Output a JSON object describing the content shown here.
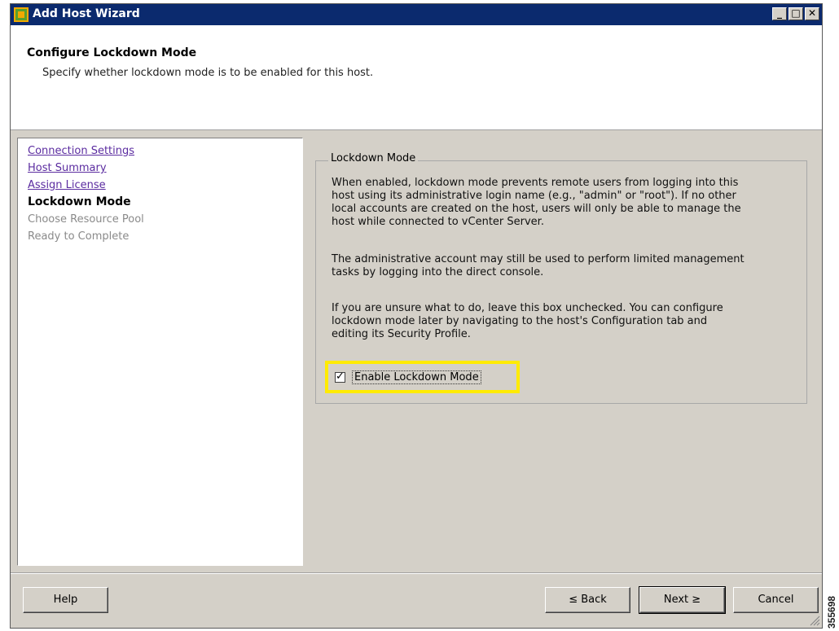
{
  "window": {
    "title": "Add Host Wizard",
    "controls": {
      "minimize": "_",
      "maximize": "□",
      "close": "✕"
    }
  },
  "header": {
    "title": "Configure Lockdown Mode",
    "subtitle": "Specify whether lockdown mode is to be enabled for this host."
  },
  "steps": [
    {
      "label": "Connection Settings",
      "state": "link"
    },
    {
      "label": "Host Summary",
      "state": "link"
    },
    {
      "label": "Assign License",
      "state": "link"
    },
    {
      "label": "Lockdown Mode",
      "state": "current"
    },
    {
      "label": "Choose Resource Pool",
      "state": "future"
    },
    {
      "label": "Ready to Complete",
      "state": "future"
    }
  ],
  "lockdown": {
    "group_label": "Lockdown Mode",
    "para1_lines": [
      "When enabled, lockdown mode prevents remote users from logging into this",
      "host using its administrative login name (e.g., \"admin\" or \"root\"). If no other",
      "local accounts are created on the host, users will only be able to manage the",
      "host while connected to vCenter Server."
    ],
    "para2_lines": [
      "The administrative account may still be used to perform limited management",
      "tasks by logging into the direct console."
    ],
    "para3_lines": [
      "If you are unsure what to do, leave this box unchecked. You can configure",
      "lockdown mode later by navigating to the host's Configuration tab and",
      "editing its Security Profile."
    ],
    "checkbox_label": "Enable Lockdown Mode",
    "checkbox_checked": true,
    "highlight_color": "#ffeb00"
  },
  "buttons": {
    "help": "Help",
    "back": "≤ Back",
    "next": "Next ≥",
    "cancel": "Cancel"
  },
  "side_number": "355698",
  "colors": {
    "titlebar": "#0b2a6e",
    "dialog_bg": "#d4d0c8",
    "link": "#5b2ca0"
  }
}
